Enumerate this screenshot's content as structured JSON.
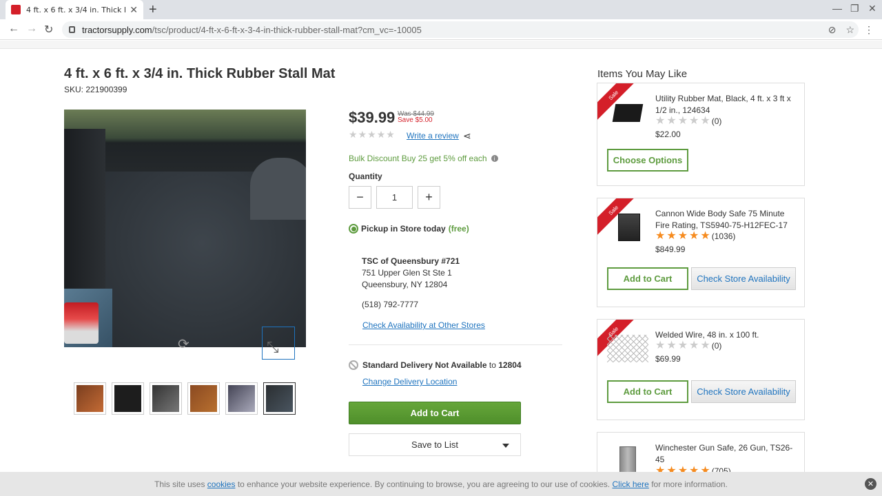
{
  "browser": {
    "tab_title": "4 ft. x 6 ft. x 3/4 in. Thick Rubber",
    "url_domain": "tractorsupply.com",
    "url_path": "/tsc/product/4-ft-x-6-ft-x-3-4-in-thick-rubber-stall-mat?cm_vc=-10005"
  },
  "product": {
    "title": "4 ft. x 6 ft. x 3/4 in. Thick Rubber Stall Mat",
    "sku": "SKU: 221900399",
    "price": "$39.99",
    "was_price": "Was $44.99",
    "save_text": "Save $5.00",
    "rating": 0,
    "write_review": "Write a review",
    "bulk_discount": "Bulk Discount Buy 25 get 5% off each",
    "quantity_label": "Quantity",
    "quantity": "1",
    "pickup_label": "Pickup in Store today",
    "pickup_free": "(free)",
    "store_name": "TSC of Queensbury #721",
    "store_address1": "751 Upper Glen St Ste 1",
    "store_address2": "Queensbury, NY 12804",
    "store_phone": "(518) 792-7777",
    "check_other_stores": "Check Availability at Other Stores",
    "delivery_label": "Standard Delivery Not Available",
    "delivery_to": "to",
    "delivery_zip": "12804",
    "change_location": "Change Delivery Location",
    "add_to_cart": "Add to Cart",
    "save_to_list": "Save to List"
  },
  "recommendations": {
    "title": "Items You May Like",
    "items": [
      {
        "name": "Utility Rubber Mat, Black, 4 ft. x 3 ft x 1/2 in., 124634",
        "rating": 0,
        "reviews": "(0)",
        "price": "$22.00",
        "primary": "Choose Options",
        "badge": "Sale"
      },
      {
        "name": "Cannon Wide Body Safe 75 Minute Fire Rating, TS5940-75-H12FEC-17",
        "rating": 5,
        "reviews": "(1036)",
        "price": "$849.99",
        "primary": "Add to Cart",
        "secondary": "Check Store Availability",
        "badge": "Sale"
      },
      {
        "name": "Welded Wire, 48 in. x 100 ft.",
        "rating": 0,
        "reviews": "(0)",
        "price": "$69.99",
        "primary": "Add to Cart",
        "secondary": "Check Store Availability",
        "badge": "Sale"
      },
      {
        "name": "Winchester Gun Safe, 26 Gun, TS26-45",
        "rating": 5,
        "reviews": "(705)"
      }
    ]
  },
  "cookie": {
    "text_before": "This site uses",
    "cookies_link": "cookies",
    "text_middle": "to enhance your website experience. By continuing to browse, you are agreeing to our use of cookies.",
    "click_here": "Click here",
    "text_after": "for more information."
  },
  "colors": {
    "brand_red": "#d41f29",
    "green": "#5d9b3e",
    "link_blue": "#1e73be",
    "star_orange": "#f68b1f"
  }
}
